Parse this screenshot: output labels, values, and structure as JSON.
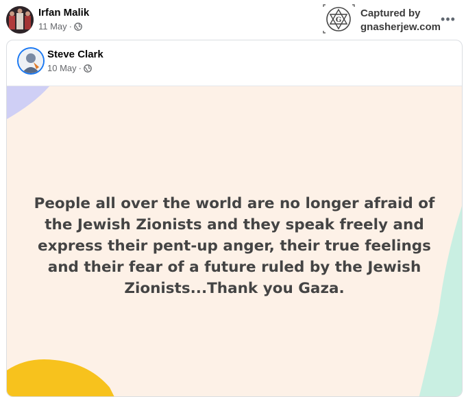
{
  "outer_post": {
    "author": "Irfan Malik",
    "date": "11 May",
    "separator": "·",
    "privacy_icon": "globe-icon",
    "more_icon": "more-options-icon",
    "more_label": "•••"
  },
  "watermark": {
    "icon": "star-of-david-logo",
    "line1": "Captured by",
    "line2": "gnasherjew.com"
  },
  "shared_post": {
    "author": "Steve Clark",
    "date": "10 May",
    "separator": "·",
    "privacy_icon": "globe-icon",
    "text": "People all over the world are no longer afraid of the Jewish Zionists and they speak freely and express their pent-up anger, their true feelings and their fear of a future ruled by the Jewish Zionists...Thank you Gaza.",
    "background_color": "#fdf1e7"
  }
}
